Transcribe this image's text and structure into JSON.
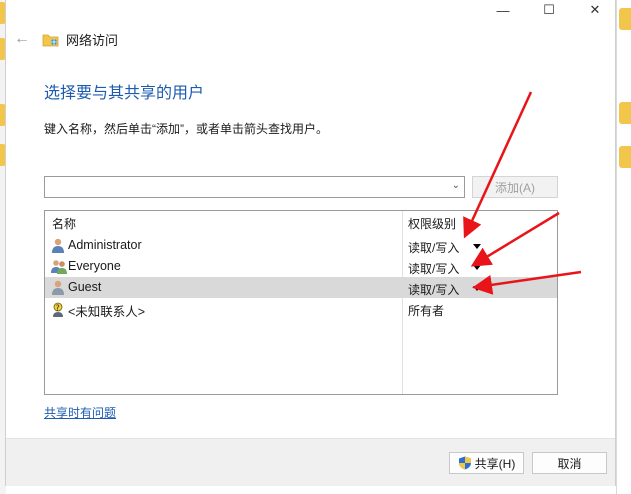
{
  "window": {
    "caption_buttons": {
      "minimize": "—",
      "maximize": "☐",
      "close": "✕"
    },
    "nav_title": "网络访问"
  },
  "dialog": {
    "heading": "选择要与其共享的用户",
    "instruction": "键入名称，然后单击“添加”，或者单击箭头查找用户。",
    "combo_value": "",
    "add_button": "添加(A)",
    "help_link": "共享时有问题",
    "share_button": "共享(H)",
    "cancel_button": "取消"
  },
  "list": {
    "headers": {
      "name": "名称",
      "permission": "权限级别"
    },
    "rows": [
      {
        "name": "Administrator",
        "permission": "读取/写入",
        "icon": "user-icon",
        "has_dropdown": true,
        "selected": false
      },
      {
        "name": "Everyone",
        "permission": "读取/写入",
        "icon": "users-group-icon",
        "has_dropdown": true,
        "selected": false
      },
      {
        "name": "Guest",
        "permission": "读取/写入",
        "icon": "user-icon",
        "has_dropdown": true,
        "selected": true
      },
      {
        "name": "<未知联系人>",
        "permission": "所有者",
        "icon": "unknown-contact-icon",
        "has_dropdown": false,
        "selected": false
      }
    ]
  },
  "colors": {
    "heading": "#1c5bb0",
    "link": "#1c5bb0",
    "selected_row": "#d9d9d9",
    "annotation_arrow": "#e8141a"
  }
}
